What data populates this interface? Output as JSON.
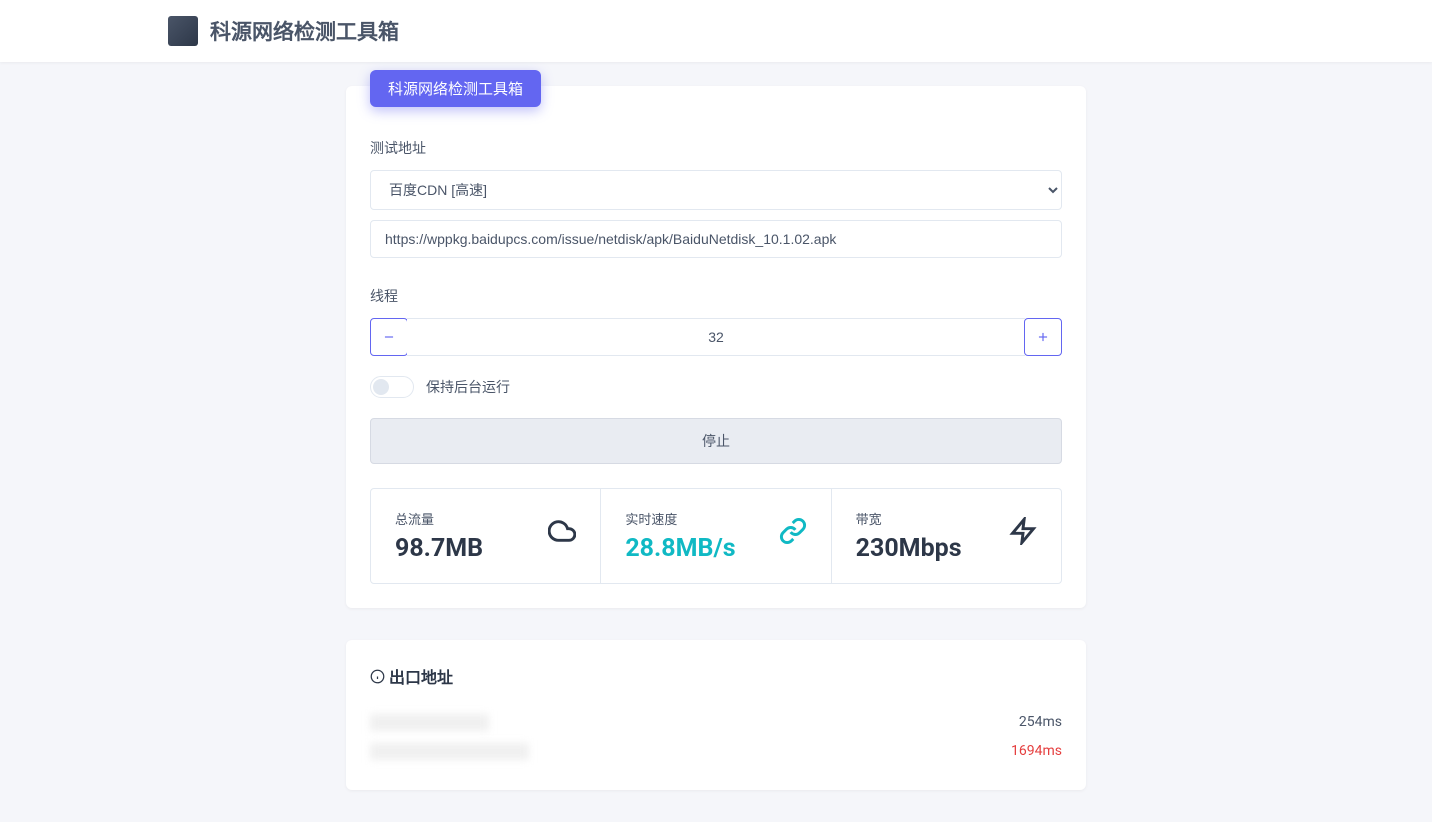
{
  "header": {
    "title": "科源网络检测工具箱"
  },
  "form": {
    "tab_label": "科源网络检测工具箱",
    "test_url_label": "测试地址",
    "cdn_selected": "百度CDN [高速]",
    "url_value": "https://wppkg.baidupcs.com/issue/netdisk/apk/BaiduNetdisk_10.1.02.apk",
    "threads_label": "线程",
    "threads_value": "32",
    "background_label": "保持后台运行",
    "stop_button": "停止"
  },
  "stats": {
    "traffic": {
      "label": "总流量",
      "value": "98.7MB"
    },
    "speed": {
      "label": "实时速度",
      "value": "28.8MB/s"
    },
    "bandwidth": {
      "label": "带宽",
      "value": "230Mbps"
    }
  },
  "exit": {
    "title": "出口地址",
    "rows": [
      {
        "addr": "████████████",
        "latency": "254ms",
        "slow": false
      },
      {
        "addr": "████████████████",
        "latency": "1694ms",
        "slow": true
      }
    ]
  }
}
